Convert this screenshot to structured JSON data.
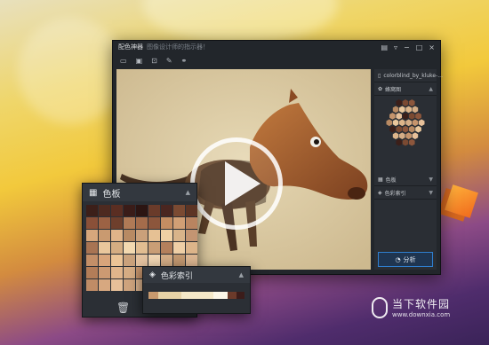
{
  "window": {
    "title": "配色神器",
    "subtitle": "图像设计师的指示器！",
    "controls": [
      "▤",
      "▿",
      "−",
      "□",
      "×"
    ],
    "toolbar_icons": [
      "open-icon",
      "save-icon",
      "export-icon",
      "eyedropper-icon",
      "link-icon"
    ]
  },
  "sidebar": {
    "file_name": "colorblind_by_kluke-...",
    "sections": [
      {
        "label": "蜂窝图",
        "icon": "palette-icon"
      },
      {
        "label": "色板",
        "icon": "swatch-icon"
      },
      {
        "label": "色彩索引",
        "icon": "tag-icon"
      }
    ],
    "analyze_label": "分析"
  },
  "swatch_panel": {
    "title": "色板",
    "colors": [
      "#3c1f19",
      "#4e2a20",
      "#5a2e22",
      "#3a1c18",
      "#2c1512",
      "#6a3b2a",
      "#4a2620",
      "#7b4a32",
      "#5c3424",
      "#8a5038",
      "#9c6244",
      "#6e3f2c",
      "#b07a56",
      "#a46c4b",
      "#8c563c",
      "#c48d62",
      "#d19f75",
      "#b98460",
      "#d7a77c",
      "#c99a70",
      "#e0b489",
      "#b88a63",
      "#caa07a",
      "#e6c194",
      "#f0d0a4",
      "#d9b48a",
      "#c49572",
      "#a87453",
      "#e9c79c",
      "#d5ad82",
      "#f3d9b0",
      "#e2bd91",
      "#c99e76",
      "#b4805c",
      "#efcfa6",
      "#ddb58a",
      "#c38f68",
      "#d8a57b",
      "#ebc496",
      "#caa27c",
      "#e5c3a0",
      "#f1d6b3",
      "#d4ad86",
      "#c29870",
      "#dcb691",
      "#b37d58",
      "#cc9a72",
      "#e0b58b",
      "#d6ad84",
      "#c5946c",
      "#ebcaa3",
      "#d9b18a",
      "#f0d1ad",
      "#e4c29c",
      "#c08c66",
      "#d7a880",
      "#e7c099",
      "#cfa47e",
      "#dcb38d",
      "#f2d5b2",
      "#d1a983",
      "#e8c7a2",
      "#c99d78"
    ],
    "footer_icons": [
      "trash-icon",
      "copy-icon"
    ]
  },
  "index_panel": {
    "title": "色彩索引",
    "colors": [
      "#c99a6e",
      "#e7d3a7",
      "#f4e8c8",
      "#fbf6e8",
      "#6b3a2a",
      "#3b1c1a"
    ],
    "weights": [
      10,
      24,
      34,
      14,
      10,
      8
    ]
  },
  "watermark": {
    "brand": "当下软件园",
    "url": "www.downxia.com"
  }
}
